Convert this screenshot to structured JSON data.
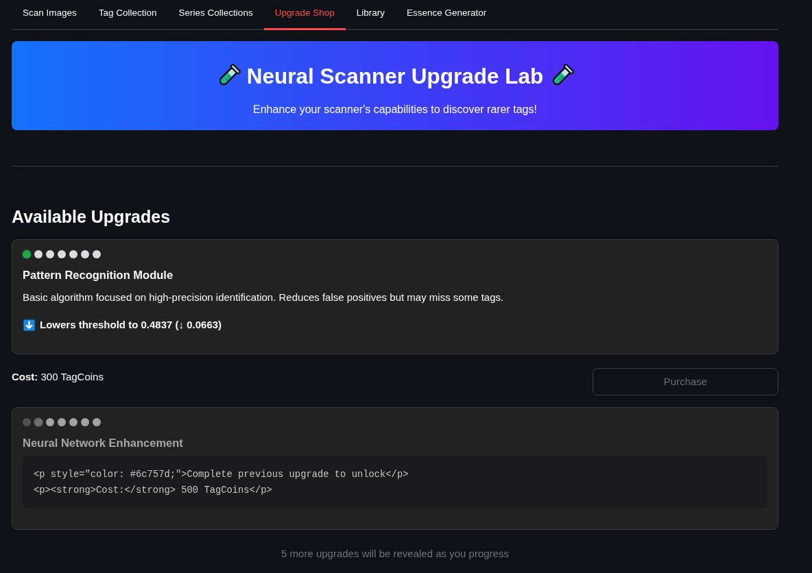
{
  "tabs": [
    {
      "label": "Scan Images",
      "selected": false
    },
    {
      "label": "Tag Collection",
      "selected": false
    },
    {
      "label": "Series Collections",
      "selected": false
    },
    {
      "label": "Upgrade Shop",
      "selected": true
    },
    {
      "label": "Library",
      "selected": false
    },
    {
      "label": "Essence Generator",
      "selected": false
    }
  ],
  "banner": {
    "title": "Neural Scanner Upgrade Lab",
    "subtitle": "Enhance your scanner's capabilities to discover rarer tags!"
  },
  "section_title": "Available Upgrades",
  "upgrades": [
    {
      "locked": false,
      "dots": [
        {
          "done": false,
          "current": true
        },
        {
          "done": false,
          "current": false
        },
        {
          "done": false,
          "current": false
        },
        {
          "done": false,
          "current": false
        },
        {
          "done": false,
          "current": false
        },
        {
          "done": false,
          "current": false
        },
        {
          "done": false,
          "current": false
        }
      ],
      "title": "Pattern Recognition Module",
      "description": "Basic algorithm focused on high-precision identification. Reduces false positives but may miss some tags.",
      "effect": "Lowers threshold to 0.4837 (↓ 0.0663)",
      "cost": "**Cost:** 300 TagCoins",
      "purchase_button": {
        "label": "Purchase",
        "disabled": true
      }
    },
    {
      "locked": true,
      "dots": [
        {
          "done": true,
          "current": false
        },
        {
          "done": false,
          "current": true
        },
        {
          "done": false,
          "current": false
        },
        {
          "done": false,
          "current": false
        },
        {
          "done": false,
          "current": false
        },
        {
          "done": false,
          "current": false
        },
        {
          "done": false,
          "current": false
        }
      ],
      "title": "Neural Network Enhancement",
      "code_lines": [
        "<p style=\"color: #6c757d;\">Complete previous upgrade to unlock</p>",
        "<p><strong>Cost:</strong> 500 TagCoins</p>"
      ]
    }
  ],
  "footer_note": "5 more upgrades will be revealed as you progress"
}
